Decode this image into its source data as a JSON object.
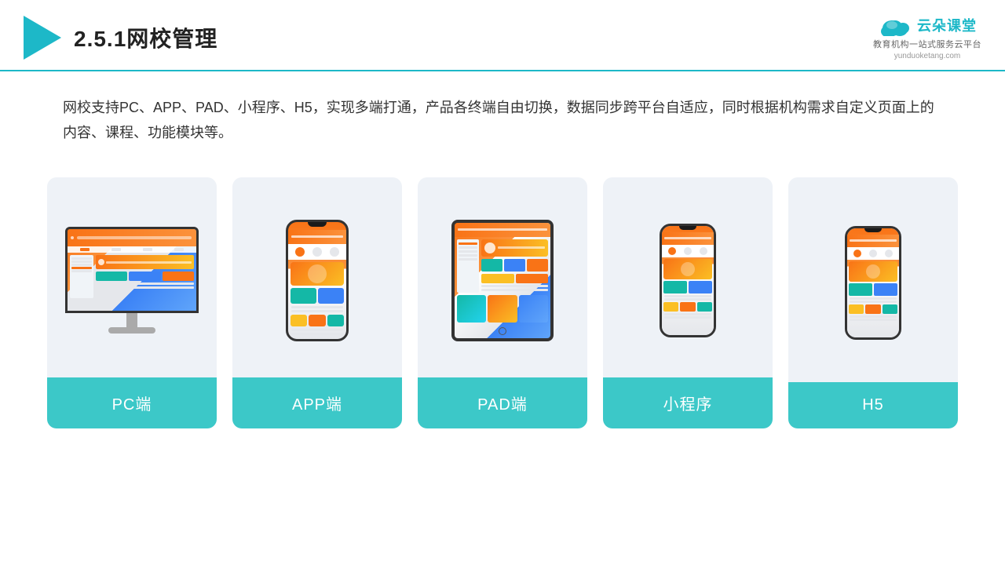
{
  "header": {
    "section_number": "2.5.1",
    "title": "网校管理",
    "brand_name": "云朵课堂",
    "brand_url": "yunduoketang.com",
    "brand_slogan": "教育机构一站式服务云平台"
  },
  "description": {
    "text": "网校支持PC、APP、PAD、小程序、H5，实现多端打通，产品各终端自由切换，数据同步跨平台自适应，同时根据机构需求自定义页面上的内容、课程、功能模块等。"
  },
  "cards": [
    {
      "id": "pc",
      "label": "PC端"
    },
    {
      "id": "app",
      "label": "APP端"
    },
    {
      "id": "pad",
      "label": "PAD端"
    },
    {
      "id": "miniapp",
      "label": "小程序"
    },
    {
      "id": "h5",
      "label": "H5"
    }
  ],
  "colors": {
    "accent": "#1db8c8",
    "card_label_bg": "#3cc8c8",
    "card_bg": "#eef2f7"
  }
}
